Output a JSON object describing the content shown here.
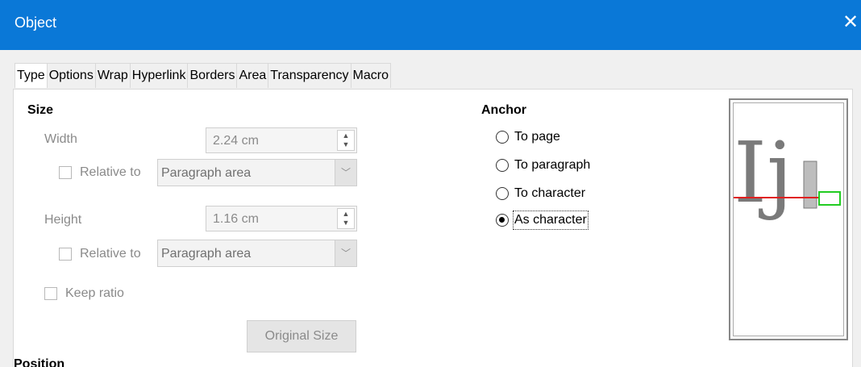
{
  "window": {
    "title": "Object",
    "close_glyph": "✕"
  },
  "tabs": [
    {
      "label": "Type",
      "active": true
    },
    {
      "label": "Options",
      "active": false
    },
    {
      "label": "Wrap",
      "active": false
    },
    {
      "label": "Hyperlink",
      "active": false
    },
    {
      "label": "Borders",
      "active": false
    },
    {
      "label": "Area",
      "active": false
    },
    {
      "label": "Transparency",
      "active": false
    },
    {
      "label": "Macro",
      "active": false
    }
  ],
  "size": {
    "title": "Size",
    "width_label": "Width",
    "width_value": "2.24 cm",
    "width_relative_label": "Relative to",
    "width_relative_value": "Paragraph area",
    "height_label": "Height",
    "height_value": "1.16 cm",
    "height_relative_label": "Relative to",
    "height_relative_value": "Paragraph area",
    "keep_ratio_label": "Keep ratio",
    "original_size_label": "Original Size"
  },
  "anchor": {
    "title": "Anchor",
    "options": [
      {
        "label": "To page",
        "checked": false
      },
      {
        "label": "To paragraph",
        "checked": false
      },
      {
        "label": "To character",
        "checked": false
      },
      {
        "label": "As character",
        "checked": true
      }
    ]
  },
  "position": {
    "title": "Position"
  },
  "preview": {
    "big_letters": "Ij"
  },
  "colors": {
    "titlebar": "#0a78d7",
    "baseline_red": "#e02020",
    "frame_green": "#22cc22"
  }
}
